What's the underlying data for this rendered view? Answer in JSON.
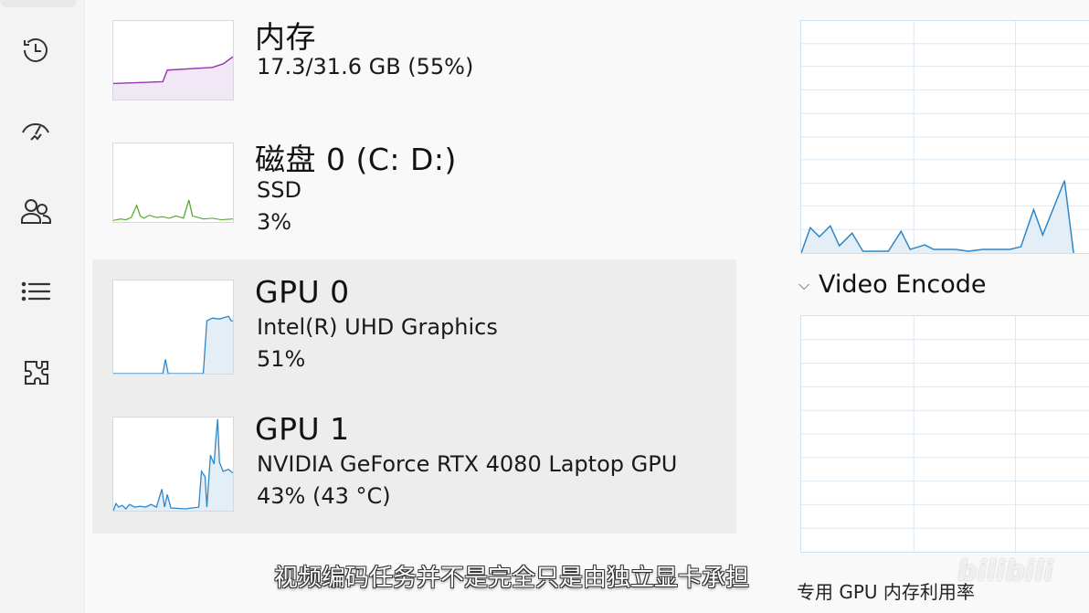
{
  "nav": {
    "items": [
      {
        "icon": "history-icon"
      },
      {
        "icon": "startup-apps-icon"
      },
      {
        "icon": "users-icon"
      },
      {
        "icon": "details-list-icon"
      },
      {
        "icon": "services-icon"
      }
    ]
  },
  "perf_items": [
    {
      "title": "内存",
      "line1": "17.3/31.6 GB (55%)",
      "line2": "",
      "color": "#9b35b5"
    },
    {
      "title": "磁盘 0 (C: D:)",
      "line1": "SSD",
      "line2": "3%",
      "color": "#4ea72c"
    },
    {
      "title": "GPU 0",
      "line1": "Intel(R) UHD Graphics",
      "line2": "51%",
      "color": "#2f86c5"
    },
    {
      "title": "GPU 1",
      "line1": "NVIDIA GeForce RTX 4080 Laptop GPU",
      "line2": "43% (43 °C)",
      "color": "#2f86c5"
    }
  ],
  "right": {
    "section_title": "Video Encode",
    "bottom_label": "专用 GPU 内存利用率"
  },
  "overlay": {
    "subtitle": "视频编码任务并不是完全只是由独立显卡承担",
    "watermark": "bilibili"
  },
  "colors": {
    "gpu_line": "#2f86c5",
    "gpu_fill": "#e3eef7",
    "memory_line": "#9b35b5",
    "disk_line": "#4ea72c",
    "selected_bg": "#ededed"
  }
}
